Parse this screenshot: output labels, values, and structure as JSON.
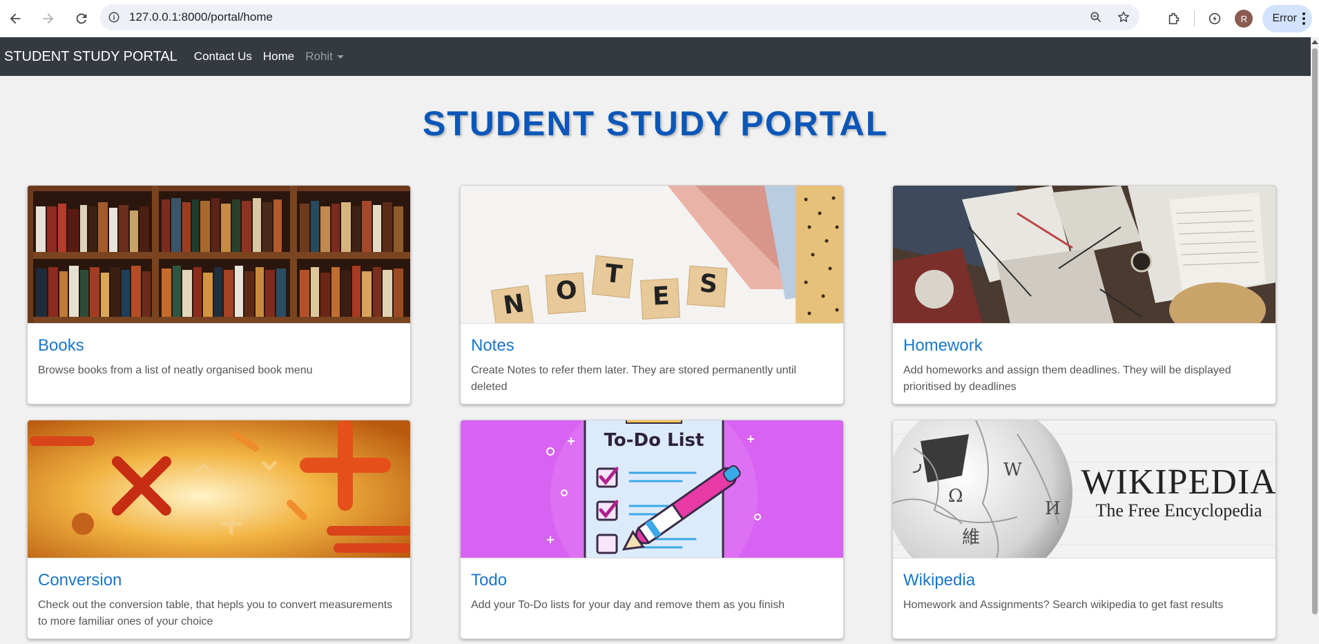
{
  "browser": {
    "url": "127.0.0.1:8000/portal/home",
    "profile_initial": "R",
    "error_label": "Error"
  },
  "navbar": {
    "brand": "STUDENT STUDY PORTAL",
    "links": [
      "Contact Us",
      "Home"
    ],
    "user": "Rohit"
  },
  "page": {
    "title": "STUDENT STUDY PORTAL"
  },
  "cards": [
    {
      "title": "Books",
      "text": "Browse books from a list of neatly organised book menu"
    },
    {
      "title": "Notes",
      "text": "Create Notes to refer them later. They are stored permanently until deleted",
      "image_letters": [
        "N",
        "O",
        "T",
        "E",
        "S"
      ]
    },
    {
      "title": "Homework",
      "text": "Add homeworks and assign them deadlines. They will be displayed prioritised by deadlines"
    },
    {
      "title": "Conversion",
      "text": "Check out the conversion table, that hepls you to convert measurements to more familiar ones of your choice"
    },
    {
      "title": "Todo",
      "text": "Add your To-Do lists for your day and remove them as you finish",
      "image_heading": "To-Do List"
    },
    {
      "title": "Wikipedia",
      "text": "Homework and Assignments? Search wikipedia to get fast results",
      "image_wordmark": "WIKIPEDIA",
      "image_tagline": "The Free Encyclopedia"
    }
  ],
  "colors": {
    "navbar_bg": "#343a40",
    "title_blue": "#0b57b8",
    "card_title": "#1a75c9",
    "page_bg": "#f1f1f1"
  }
}
